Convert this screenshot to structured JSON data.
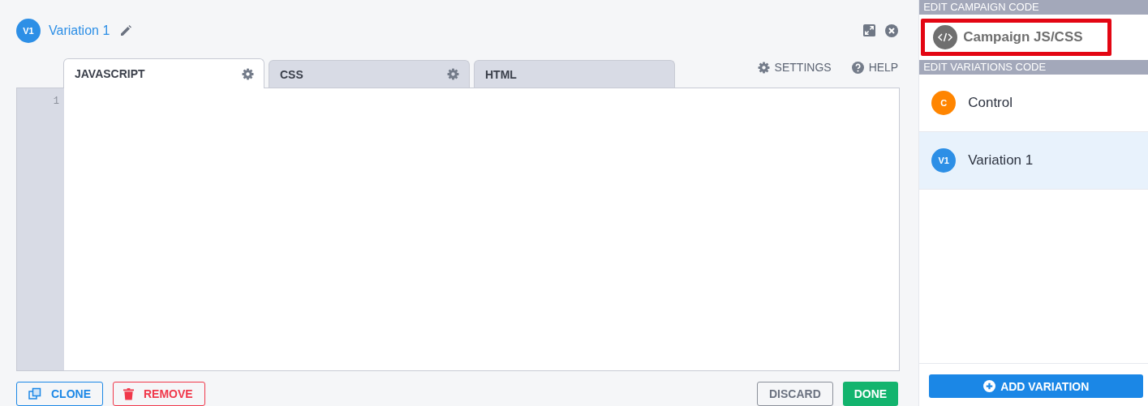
{
  "header": {
    "badge": "V1",
    "title": "Variation 1"
  },
  "tabs": [
    {
      "label": "JAVASCRIPT",
      "selected": true,
      "gear": true
    },
    {
      "label": "CSS",
      "selected": false,
      "gear": true
    },
    {
      "label": "HTML",
      "selected": false,
      "gear": false
    }
  ],
  "toolbar": {
    "settings": "SETTINGS",
    "help": "HELP"
  },
  "editor": {
    "line_numbers": [
      "1"
    ]
  },
  "footer": {
    "clone": "CLONE",
    "remove": "REMOVE",
    "discard": "DISCARD",
    "done": "DONE"
  },
  "sidebar": {
    "campaign_heading": "EDIT CAMPAIGN CODE",
    "campaign_item": {
      "label": "Campaign JS/CSS",
      "highlighted": true
    },
    "variations_heading": "EDIT VARIATIONS CODE",
    "variations": [
      {
        "badge": "C",
        "label": "Control",
        "color": "#ff8500",
        "selected": false
      },
      {
        "badge": "V1",
        "label": "Variation 1",
        "color": "#2d8fe6",
        "selected": true
      }
    ],
    "add_button": "ADD VARIATION"
  }
}
